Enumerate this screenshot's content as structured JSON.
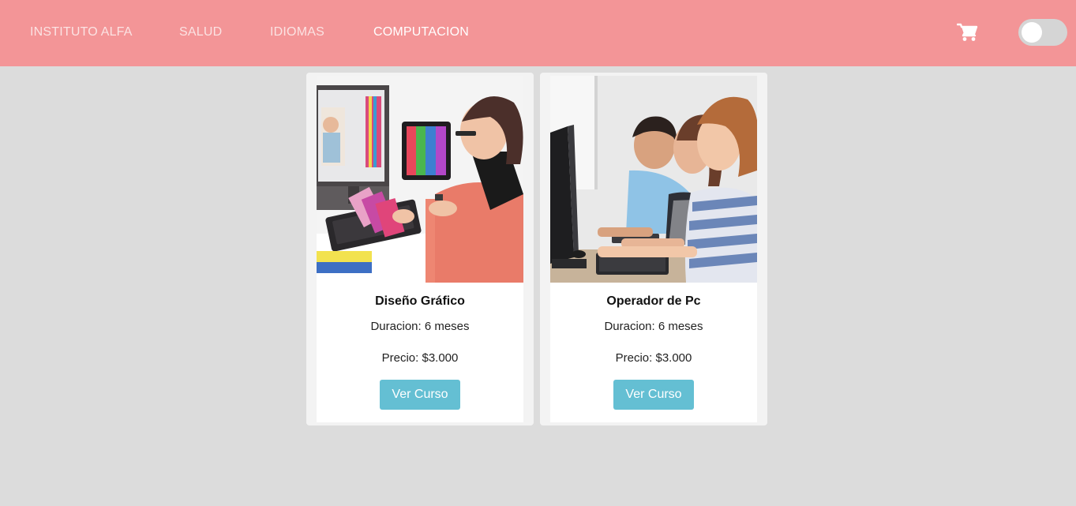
{
  "colors": {
    "navbar_bg": "#f39597",
    "button_bg": "#64bfd3",
    "page_bg": "#dcdcdc"
  },
  "navbar": {
    "brand": "INSTITUTO ALFA",
    "links": [
      "SALUD",
      "IDIOMAS",
      "COMPUTACION"
    ],
    "active_link": "COMPUTACION",
    "cart_icon": "shopping-cart-icon",
    "theme_toggle": {
      "state": "off"
    }
  },
  "courses": [
    {
      "title": "Diseño Gráfico",
      "duration": "Duracion: 6 meses",
      "price": "Precio: $3.000",
      "button": "Ver Curso",
      "image": "graphic-design-photo"
    },
    {
      "title": "Operador de Pc",
      "duration": "Duracion: 6 meses",
      "price": "Precio: $3.000",
      "button": "Ver Curso",
      "image": "computer-class-photo"
    }
  ]
}
